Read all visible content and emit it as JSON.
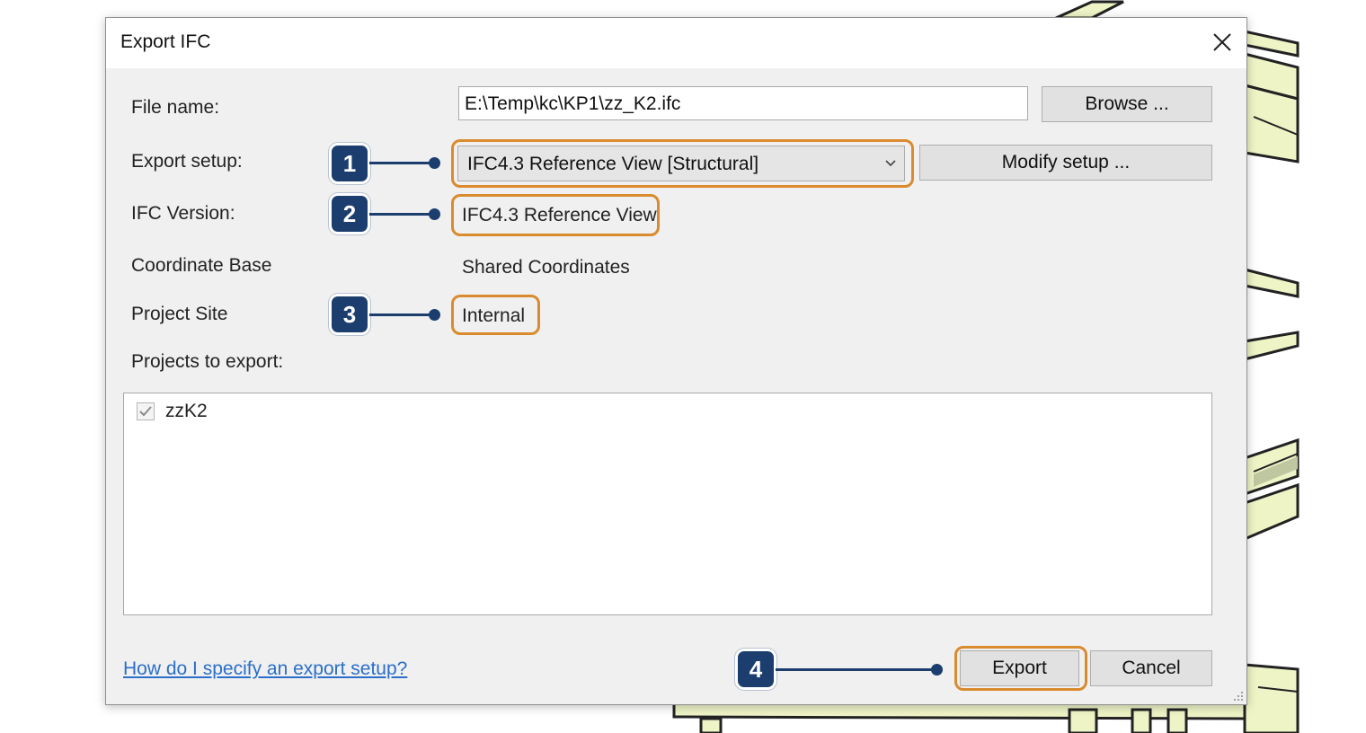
{
  "window": {
    "title": "Export IFC"
  },
  "form": {
    "file_name_label": "File name:",
    "file_name_value": "E:\\Temp\\kc\\KP1\\zz_K2.ifc",
    "browse_label": "Browse ...",
    "export_setup_label": "Export setup:",
    "export_setup_value": "IFC4.3 Reference View [Structural]",
    "modify_setup_label": "Modify setup ...",
    "ifc_version_label": "IFC Version:",
    "ifc_version_value": "IFC4.3 Reference View",
    "coordinate_base_label": "Coordinate Base",
    "coordinate_base_value": "Shared Coordinates",
    "project_site_label": "Project Site",
    "project_site_value": "Internal",
    "projects_label": "Projects to export:"
  },
  "projects": [
    {
      "name": "zzK2",
      "checked": true
    }
  ],
  "footer": {
    "help_link": "How do I specify an export setup?",
    "export_label": "Export",
    "cancel_label": "Cancel"
  },
  "callouts": {
    "one": "1",
    "two": "2",
    "three": "3",
    "four": "4"
  },
  "colors": {
    "highlight": "#d98b2e",
    "callout": "#1c3e6e",
    "background_model": "#eef4c6"
  }
}
